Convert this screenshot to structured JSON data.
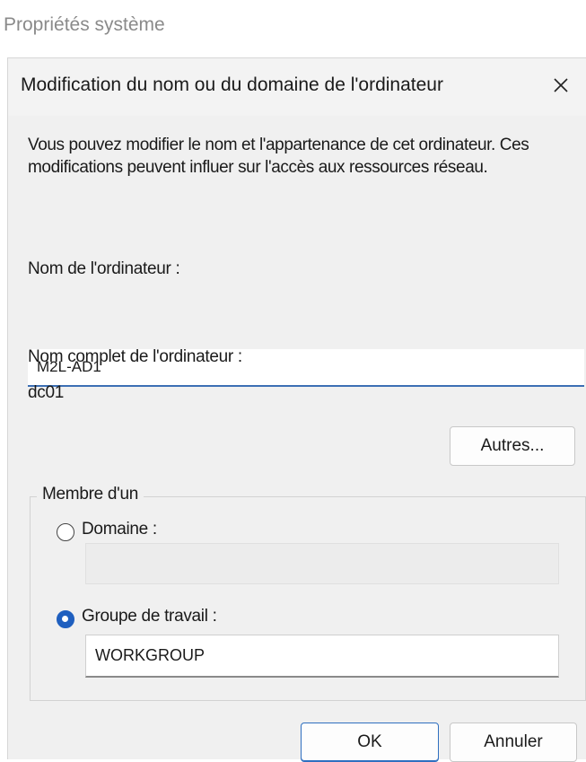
{
  "background_window": {
    "title": "Propriétés système"
  },
  "dialog": {
    "title": "Modification du nom ou du domaine de l'ordinateur",
    "close_icon": "close-icon",
    "description": "Vous pouvez modifier le nom et l'appartenance de cet ordinateur. Ces modifications peuvent influer sur l'accès aux ressources réseau.",
    "computer_name_label": "Nom de l'ordinateur :",
    "computer_name_value": "M2L-AD1",
    "full_name_label": "Nom complet de l'ordinateur :",
    "full_name_value": "dc01",
    "more_button": "Autres...",
    "member_of": {
      "legend": "Membre d'un",
      "domain_label": "Domaine :",
      "domain_value": "",
      "domain_selected": false,
      "workgroup_label": "Groupe de travail :",
      "workgroup_value": "WORKGROUP",
      "workgroup_selected": true
    },
    "ok_button": "OK",
    "cancel_button": "Annuler"
  },
  "colors": {
    "accent": "#1f5fbf",
    "input_underline": "#3c6fb4"
  }
}
